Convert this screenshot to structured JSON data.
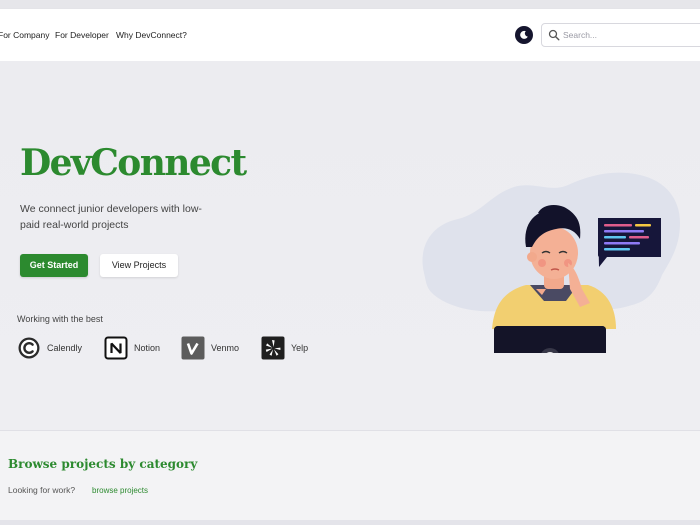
{
  "nav": {
    "links": [
      "For Company",
      "For Developer",
      "Why DevConnect?"
    ],
    "search_placeholder": "Search..."
  },
  "hero": {
    "title": "DevConnect",
    "description": "We connect junior developers with low-paid real-world projects",
    "primary_button": "Get Started",
    "secondary_button": "View Projects",
    "partners_label": "Working with the best",
    "partners": [
      {
        "name": "Calendly",
        "icon": "calendly-logo"
      },
      {
        "name": "Notion",
        "icon": "notion-logo"
      },
      {
        "name": "Venmo",
        "icon": "venmo-logo"
      },
      {
        "name": "Yelp",
        "icon": "yelp-logo"
      }
    ]
  },
  "categories": {
    "title": "Browse projects by category",
    "prompt": "Looking for work?",
    "link": "browse projects"
  },
  "colors": {
    "brand_green": "#2c8a2f",
    "nav_background": "#ffffff",
    "page_background": "#ececf0"
  }
}
